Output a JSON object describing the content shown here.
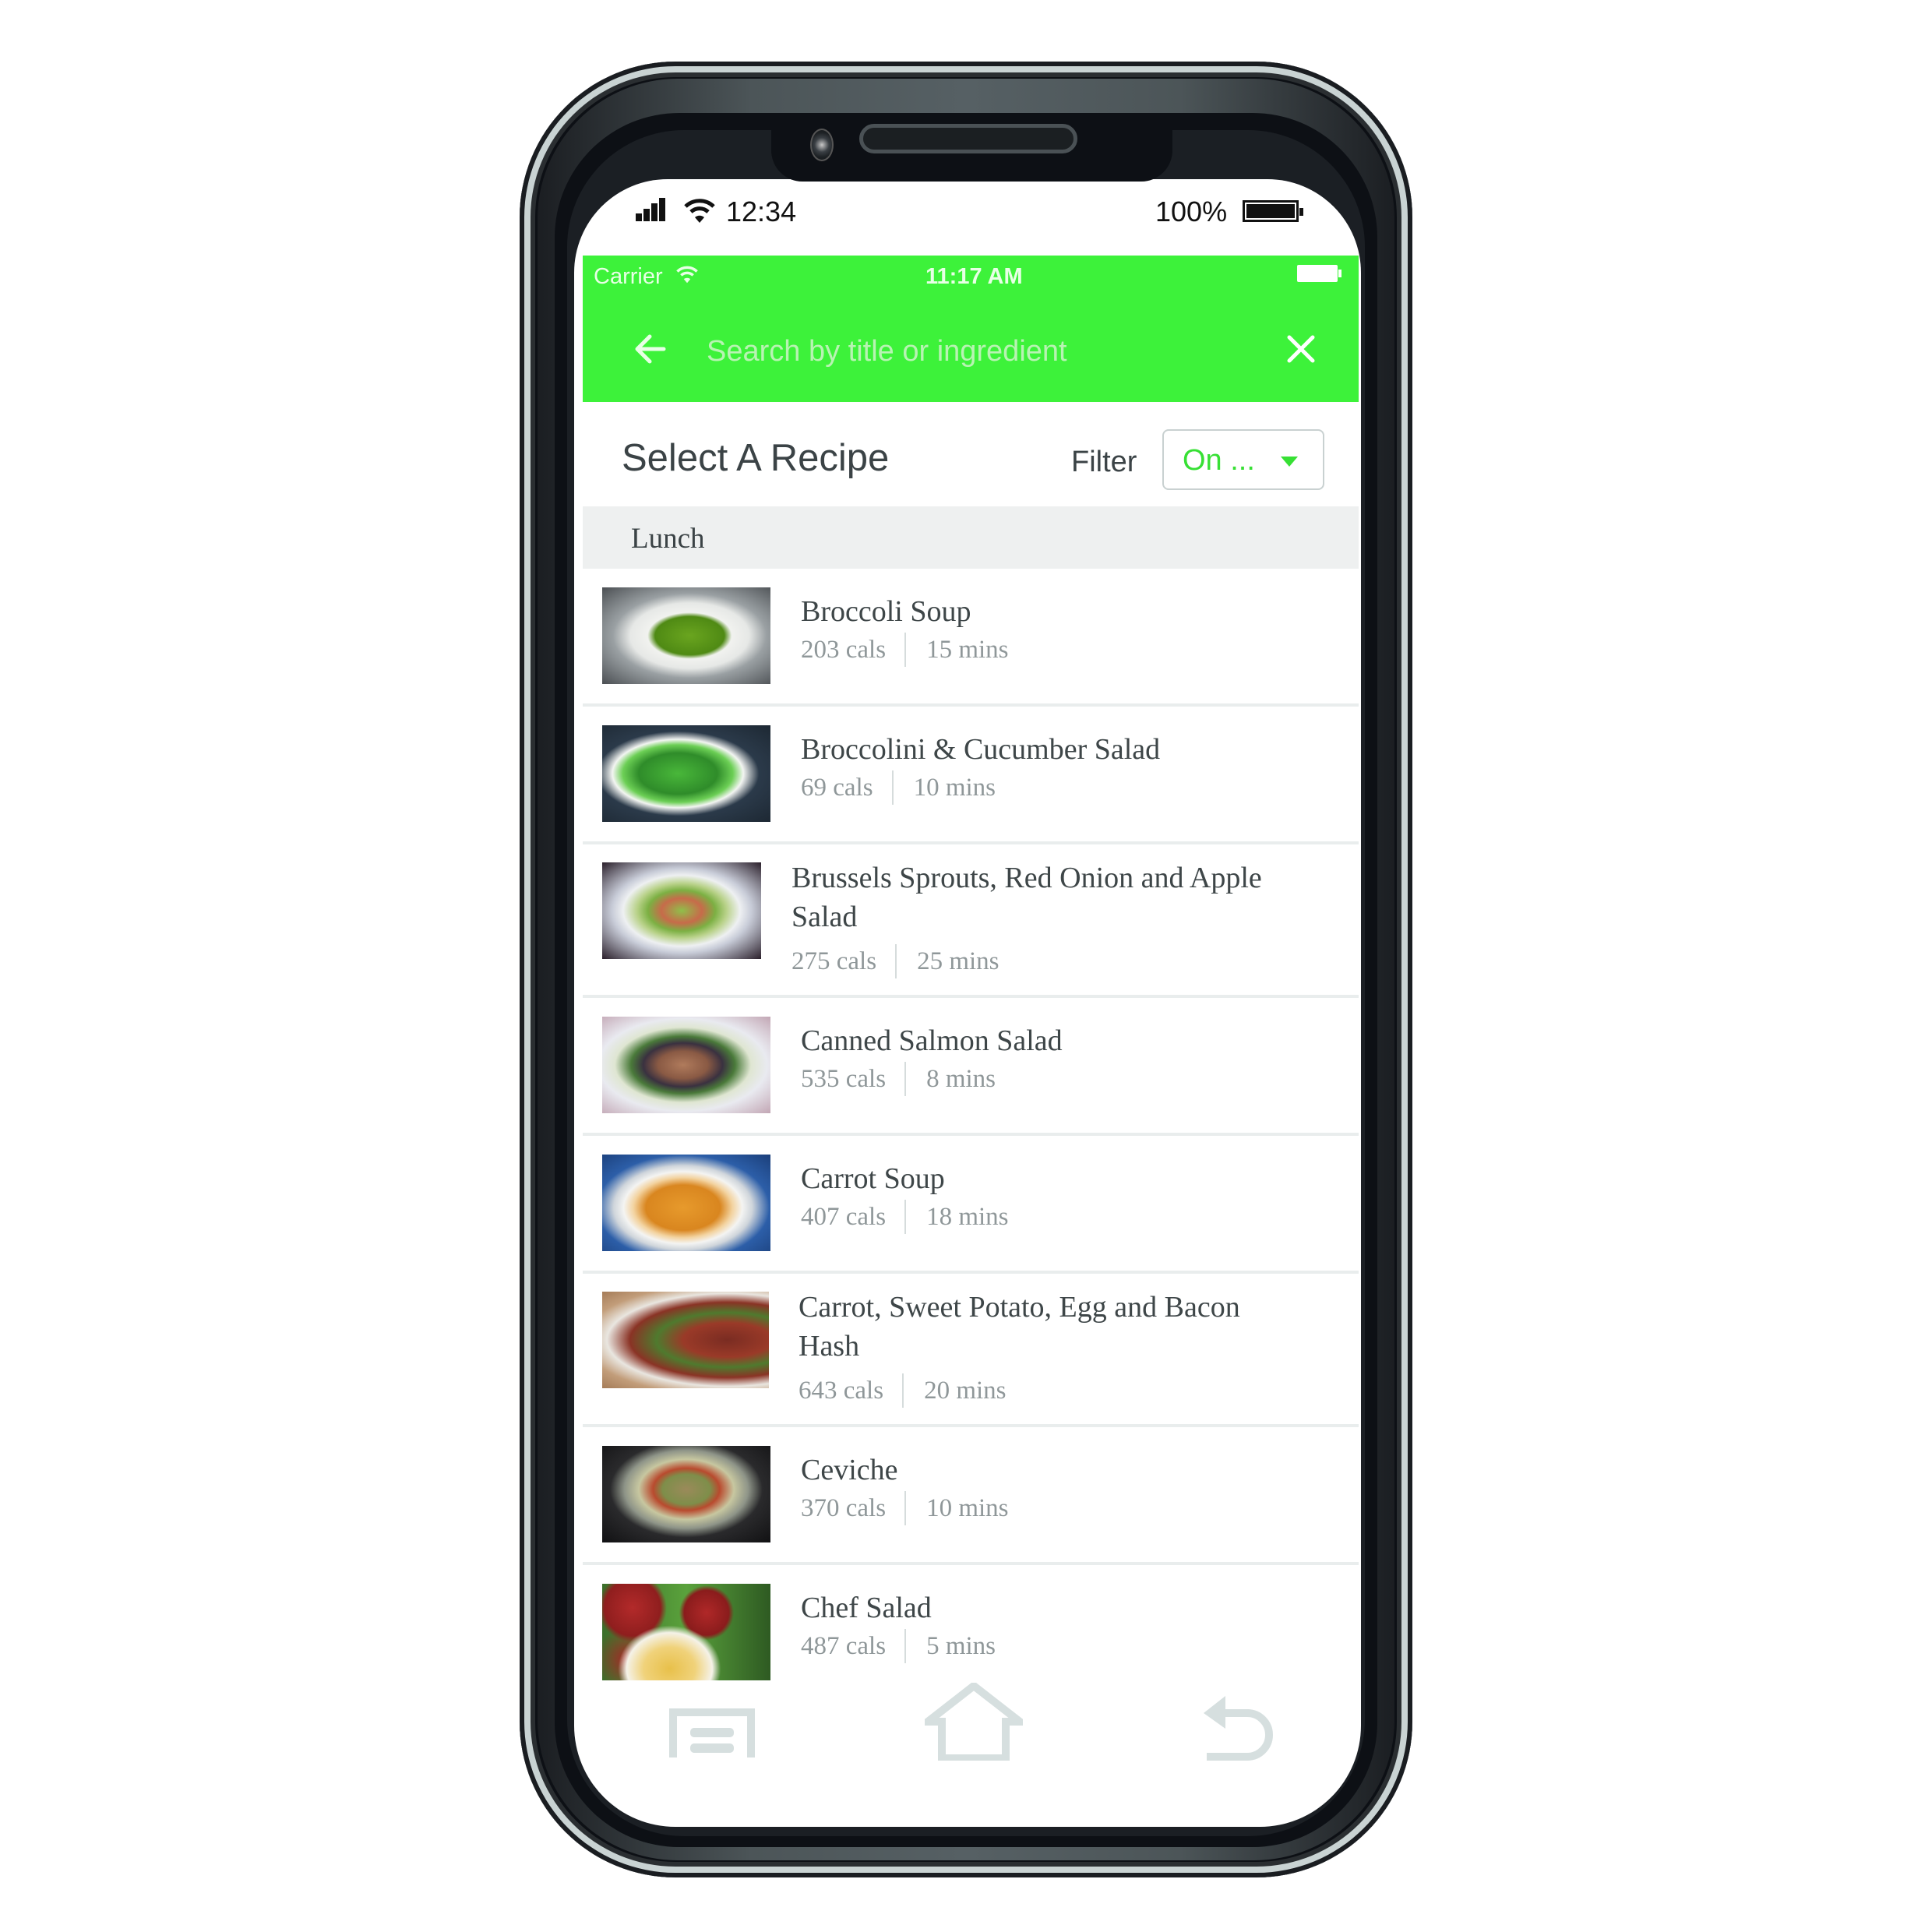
{
  "device_status_bar": {
    "time": "12:34",
    "battery_percent": "100%",
    "signal_icon": "cellular-signal-icon",
    "wifi_icon": "wifi-icon",
    "battery_icon": "battery-icon"
  },
  "app_status_bar": {
    "carrier": "Carrier",
    "time": "11:17 AM",
    "wifi_icon": "wifi-icon",
    "battery_icon": "battery-icon"
  },
  "search": {
    "placeholder": "Search by title or ingredient",
    "value": "",
    "back_icon": "arrow-left-icon",
    "clear_icon": "close-icon"
  },
  "header": {
    "title": "Select A Recipe",
    "filter_label": "Filter",
    "filter_value": "On ...",
    "filter_caret_icon": "caret-down-icon"
  },
  "colors": {
    "accent_green": "#3df23a",
    "filter_green": "#37e034",
    "text_dark": "#3b4346",
    "text_muted": "#8f9799"
  },
  "section": {
    "label": "Lunch"
  },
  "recipes": [
    {
      "title": "Broccoli Soup",
      "calories": "203 cals",
      "time": "15 mins",
      "thumb": "broccoli-soup-photo"
    },
    {
      "title": "Broccolini & Cucumber Salad",
      "calories": "69 cals",
      "time": "10 mins",
      "thumb": "broccolini-salad-photo"
    },
    {
      "title": "Brussels Sprouts, Red Onion and Apple Salad",
      "calories": "275 cals",
      "time": "25 mins",
      "thumb": "brussels-sprouts-salad-photo"
    },
    {
      "title": "Canned Salmon Salad",
      "calories": "535 cals",
      "time": "8 mins",
      "thumb": "salmon-salad-photo"
    },
    {
      "title": "Carrot Soup",
      "calories": "407 cals",
      "time": "18 mins",
      "thumb": "carrot-soup-photo"
    },
    {
      "title": "Carrot, Sweet Potato, Egg and Bacon Hash",
      "calories": "643 cals",
      "time": "20 mins",
      "thumb": "hash-photo"
    },
    {
      "title": "Ceviche",
      "calories": "370 cals",
      "time": "10 mins",
      "thumb": "ceviche-photo"
    },
    {
      "title": "Chef Salad",
      "calories": "487 cals",
      "time": "5 mins",
      "thumb": "chef-salad-photo"
    }
  ],
  "nav_bar": {
    "recents_icon": "recent-apps-icon",
    "home_icon": "home-icon",
    "back_icon": "back-icon"
  }
}
